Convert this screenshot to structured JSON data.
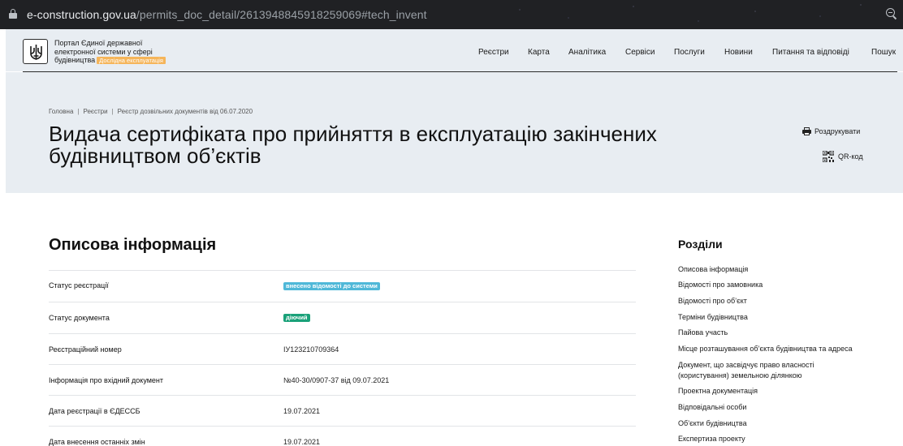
{
  "browser": {
    "url_host": "e-construction.gov.ua",
    "url_path": "/permits_doc_detail/2613948845918259069#tech_invent"
  },
  "header": {
    "portal_name": "Портал Єдиної державної електронної системи у сфері будівництва",
    "beta_label": "Дослідна експлуатація",
    "beta_color": "#f5b55a",
    "nav": [
      "Реєстри",
      "Карта",
      "Аналітика",
      "Сервіси",
      "Послуги",
      "Новини",
      "Питання та відповіді",
      "Пошук"
    ]
  },
  "hero": {
    "breadcrumb": [
      "Головна",
      "Реєстри",
      "Реєстр дозвільних документів від 06.07.2020"
    ],
    "title": "Видача сертифіката про прийняття в експлуатацію закінчених будівництвом об’єктів",
    "print_label": "Роздрукувати",
    "qr_label": "QR-код"
  },
  "main": {
    "section_title": "Описова інформація",
    "rows": [
      {
        "label": "Статус реєстрації",
        "value": "внесено відомості до системи",
        "badge_color": "#4fb8d8"
      },
      {
        "label": "Статус документа",
        "value": "діючий",
        "badge_color": "#1aa179"
      },
      {
        "label": "Реєстраційний номер",
        "value": "ІУ123210709364"
      },
      {
        "label": "Інформація про вхідний документ",
        "value": "№40-30/0907-37 від 09.07.2021"
      },
      {
        "label": "Дата реєстрації в ЄДЕССБ",
        "value": "19.07.2021"
      },
      {
        "label": "Дата внесення останніх змін",
        "value": "19.07.2021"
      }
    ]
  },
  "sidebar": {
    "title": "Розділи",
    "links": [
      "Описова інформація",
      "Відомості про замовника",
      "Відомості про об’єкт",
      "Терміни будівництва",
      "Пайова участь",
      "Місце розташування об’єкта будівництва та адреса",
      "Документ, що засвідчує право власності (користування) земельною ділянкою",
      "Проектна документація",
      "Відповідальні особи",
      "Об’єкти будівництва",
      "Експертиза проекту"
    ]
  }
}
